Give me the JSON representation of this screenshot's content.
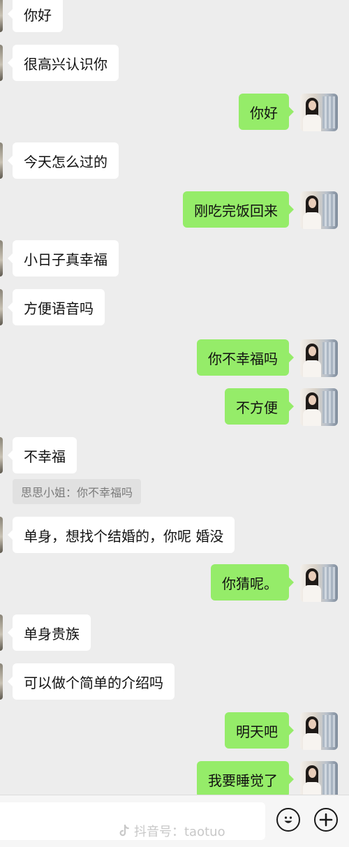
{
  "messages": [
    {
      "side": "in",
      "text": "你好"
    },
    {
      "side": "in",
      "text": "很高兴认识你"
    },
    {
      "side": "out",
      "text": "你好"
    },
    {
      "side": "in",
      "text": "今天怎么过的"
    },
    {
      "side": "out",
      "text": "刚吃完饭回来"
    },
    {
      "side": "in",
      "text": "小日子真幸福"
    },
    {
      "side": "in",
      "text": "方便语音吗"
    },
    {
      "side": "out",
      "text": "你不幸福吗"
    },
    {
      "side": "out",
      "text": "不方便"
    },
    {
      "side": "in",
      "text": "不幸福"
    },
    {
      "side": "in",
      "text": "单身，想找个结婚的，你呢 婚没"
    },
    {
      "side": "out",
      "text": "你猜呢。"
    },
    {
      "side": "in",
      "text": "单身贵族"
    },
    {
      "side": "in",
      "text": "可以做个简单的介绍吗"
    },
    {
      "side": "out",
      "text": "明天吧"
    },
    {
      "side": "out",
      "text": "我要睡觉了"
    }
  ],
  "quote": {
    "text": "思思小姐：你不幸福吗"
  },
  "input_bar": {
    "watermark": "抖音号：taotuo",
    "emoji_icon": "smiley-face-icon",
    "plus_icon": "plus-icon"
  },
  "colors": {
    "background": "#ededed",
    "incoming_bubble": "#ffffff",
    "outgoing_bubble": "#95ec69"
  }
}
